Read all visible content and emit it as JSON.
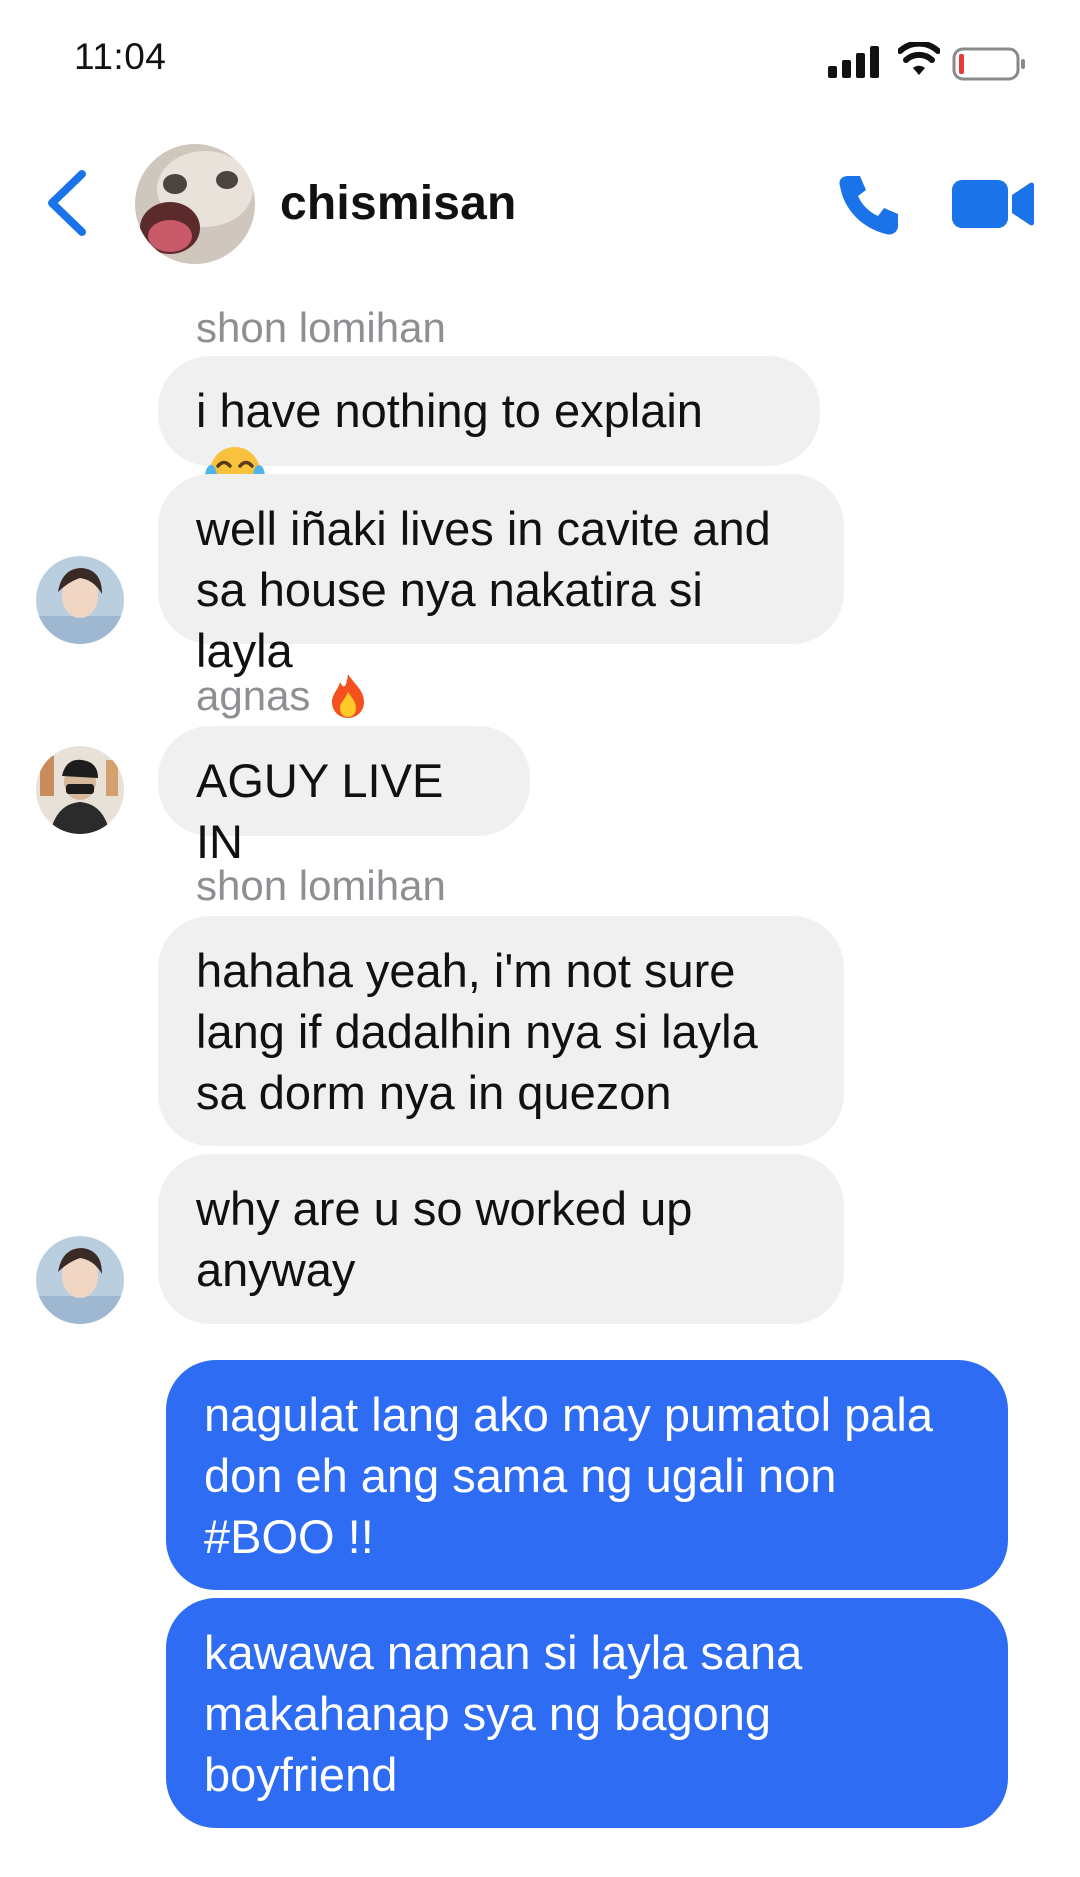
{
  "status_bar": {
    "time": "11:04"
  },
  "header": {
    "title": "chismisan",
    "back_icon": "chevron-left-icon",
    "call_icon": "phone-icon",
    "video_icon": "video-camera-icon",
    "accent": "#1a73e8"
  },
  "messages": [
    {
      "sender": "shon lomihan",
      "text": "i have nothing to explain",
      "emoji": "tears-of-joy"
    },
    {
      "text": "well iñaki lives in cavite and\nsa house nya nakatira si layla"
    },
    {
      "sender": "agnas",
      "sender_emoji": "fire",
      "text": "AGUY LIVE IN"
    },
    {
      "sender": "shon lomihan",
      "text": "hahaha yeah, i'm not sure\nlang if dadalhin nya si layla\nsa dorm nya in quezon"
    },
    {
      "text": "why are u so worked up\nanyway"
    },
    {
      "text": "nagulat lang ako may pumatol pala\ndon eh ang sama ng ugali non\n#BOO !!",
      "outgoing": true
    },
    {
      "text": "kawawa naman si layla sana\nmakahanap sya ng bagong\nboyfriend",
      "outgoing": true
    }
  ],
  "colors": {
    "incoming_bubble": "#f0f0f0",
    "outgoing_bubble": "#2f6cf4"
  }
}
